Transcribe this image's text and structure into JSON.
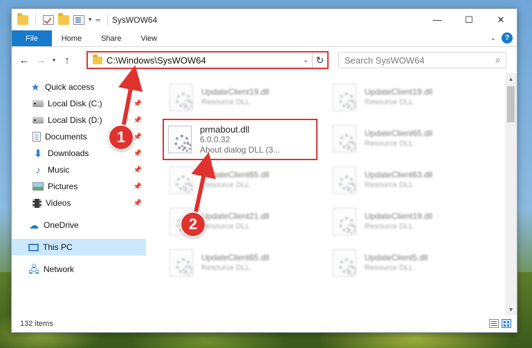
{
  "window": {
    "title": "SysWOW64",
    "controls": {
      "minimize": "—",
      "maximize": "☐",
      "close": "✕"
    }
  },
  "ribbon": {
    "tabs": [
      {
        "label": "File"
      },
      {
        "label": "Home"
      },
      {
        "label": "Share"
      },
      {
        "label": "View"
      }
    ],
    "help_label": "?"
  },
  "address": {
    "path": "C:\\Windows\\SysWOW64",
    "search_placeholder": "Search SysWOW64"
  },
  "nav": {
    "quick_access": "Quick access",
    "items": [
      {
        "label": "Local Disk (C:)",
        "icon": "disk-icon"
      },
      {
        "label": "Local Disk (D:)",
        "icon": "disk-icon"
      },
      {
        "label": "Documents",
        "icon": "documents-icon"
      },
      {
        "label": "Downloads",
        "icon": "downloads-icon"
      },
      {
        "label": "Music",
        "icon": "music-icon"
      },
      {
        "label": "Pictures",
        "icon": "pictures-icon"
      },
      {
        "label": "Videos",
        "icon": "videos-icon"
      }
    ],
    "onedrive": "OneDrive",
    "this_pc": "This PC",
    "network": "Network"
  },
  "files": [
    {
      "name": "UpdateClient19.dll",
      "type": "Resource DLL"
    },
    {
      "name": "UpdateClient19.dll",
      "type": "Resource DLL"
    },
    {
      "name": "prmabout.dll",
      "version": "6.0.0.32",
      "description": "About dialog DLL (3..."
    },
    {
      "name": "UpdateClient65.dll",
      "type": "Resource DLL"
    },
    {
      "name": "UpdateClient65.dll",
      "type": "Resource DLL"
    },
    {
      "name": "UpdateClient63.dll",
      "type": "Resource DLL"
    },
    {
      "name": "UpdateClient21.dll",
      "type": "Resource DLL"
    },
    {
      "name": "UpdateClient19.dll",
      "type": "Resource DLL"
    },
    {
      "name": "UpdateClient65.dll",
      "type": "Resource DLL"
    },
    {
      "name": "UpdateClient5.dll",
      "type": "Resource DLL"
    }
  ],
  "status": {
    "item_count": "132 items"
  },
  "annotations": [
    {
      "number": "1"
    },
    {
      "number": "2"
    }
  ],
  "colors": {
    "accent": "#1979ca",
    "highlight": "#e0322f",
    "selection": "#cce8ff"
  }
}
